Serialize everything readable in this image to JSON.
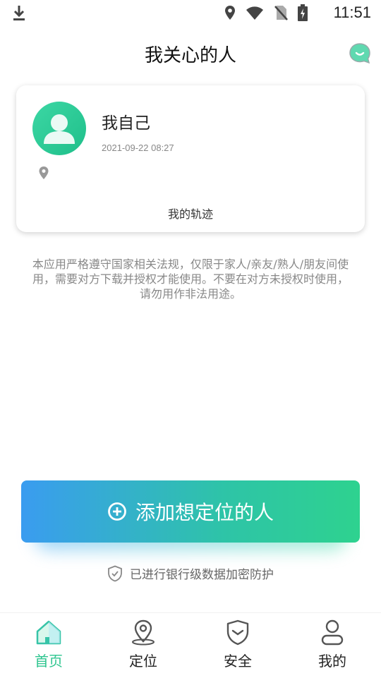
{
  "status_bar": {
    "time": "11:51"
  },
  "header": {
    "title": "我关心的人"
  },
  "card": {
    "name": "我自己",
    "timestamp": "2021-09-22 08:27",
    "track_label": "我的轨迹"
  },
  "notice": "本应用严格遵守国家相关法规，仅限于家人/亲友/熟人/朋友间使用，需要对方下载并授权才能使用。不要在对方未授权时使用，请勿用作非法用途。",
  "add_button": {
    "label": "添加想定位的人"
  },
  "security_text": "已进行银行级数据加密防护",
  "tabs": [
    {
      "label": "首页",
      "icon": "home-icon",
      "active": true
    },
    {
      "label": "定位",
      "icon": "location-icon",
      "active": false
    },
    {
      "label": "安全",
      "icon": "shield-icon",
      "active": false
    },
    {
      "label": "我的",
      "icon": "user-icon",
      "active": false
    }
  ],
  "colors": {
    "accent": "#2ec58f",
    "gradient_start": "#3a9cf0",
    "gradient_end": "#2ed28f"
  }
}
